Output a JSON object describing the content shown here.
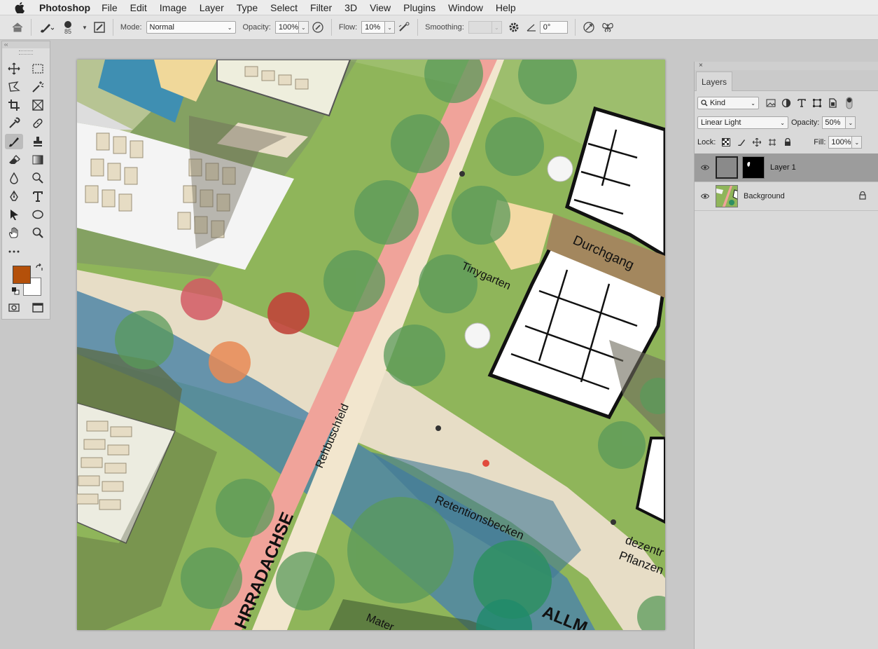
{
  "menubar": {
    "apple_icon": "apple-logo-icon",
    "app_name": "Photoshop",
    "items": [
      "File",
      "Edit",
      "Image",
      "Layer",
      "Type",
      "Select",
      "Filter",
      "3D",
      "View",
      "Plugins",
      "Window",
      "Help"
    ]
  },
  "options_bar": {
    "brush_size": "85",
    "mode_label": "Mode:",
    "mode_value": "Normal",
    "opacity_label": "Opacity:",
    "opacity_value": "100%",
    "flow_label": "Flow:",
    "flow_value": "10%",
    "smoothing_label": "Smoothing:",
    "smoothing_value": "",
    "angle_value": "0°"
  },
  "tools_panel": {
    "collapse_label": "‹‹",
    "foreground_color": "#b4500a",
    "background_color": "#ffffff"
  },
  "map": {
    "labels": {
      "durchgang": "Durchgang",
      "tinygarten": "Tinygarten",
      "rehbuschfeld": "Rehbuschfeld",
      "retentionsbecken": "Retentionsbecken",
      "radachse": "HRRADACHSE",
      "dezentr": "dezentr",
      "pflanzen": "Pflanzen",
      "allm": "ALLM",
      "mater": "Mater"
    }
  },
  "layers_panel": {
    "close_label": "×",
    "tab_label": "Layers",
    "filter_kind": "Kind",
    "blend_mode": "Linear Light",
    "opacity_label": "Opacity:",
    "opacity_value": "50%",
    "lock_label": "Lock:",
    "fill_label": "Fill:",
    "fill_value": "100%",
    "layers": [
      {
        "name": "Layer 1",
        "selected": true
      },
      {
        "name": "Background",
        "selected": false,
        "locked": true
      }
    ]
  }
}
